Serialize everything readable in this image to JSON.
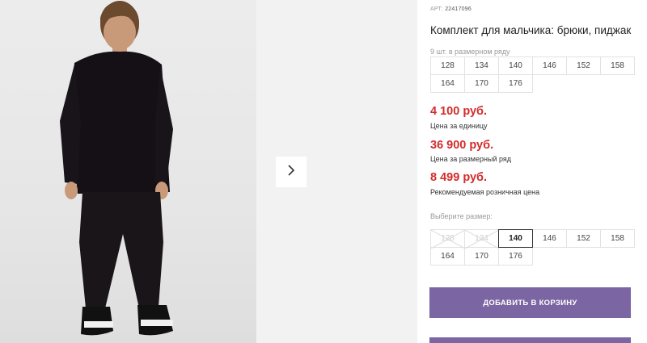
{
  "product": {
    "article_label": "АРТ:",
    "article_number": "22417096",
    "title": "Комплект для мальчика: брюки, пиджак"
  },
  "size_row": {
    "note": "9 шт. в размерном ряду",
    "sizes": [
      "128",
      "134",
      "140",
      "146",
      "152",
      "158",
      "164",
      "170",
      "176"
    ]
  },
  "prices": [
    {
      "value": "4 100 руб.",
      "label": "Цена за единицу"
    },
    {
      "value": "36 900 руб.",
      "label": "Цена за размерный ряд"
    },
    {
      "value": "8 499 руб.",
      "label": "Рекомендуемая розничная цена"
    }
  ],
  "size_select": {
    "label": "Выберите размер:",
    "options": [
      {
        "size": "128",
        "state": "unavailable"
      },
      {
        "size": "134",
        "state": "unavailable"
      },
      {
        "size": "140",
        "state": "selected"
      },
      {
        "size": "146",
        "state": "available"
      },
      {
        "size": "152",
        "state": "available"
      },
      {
        "size": "158",
        "state": "available"
      },
      {
        "size": "164",
        "state": "available"
      },
      {
        "size": "170",
        "state": "available"
      },
      {
        "size": "176",
        "state": "available"
      }
    ]
  },
  "buttons": {
    "add_to_cart": "ДОБАВИТЬ В КОРЗИНУ"
  },
  "gallery": {
    "next_icon": "chevron-right-icon"
  },
  "colors": {
    "price": "#d42b2b",
    "button": "#7b66a3"
  }
}
